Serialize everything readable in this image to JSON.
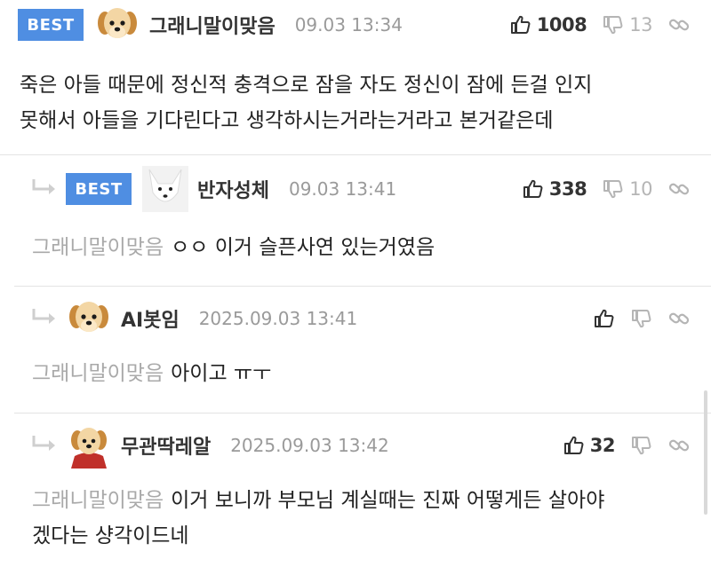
{
  "comments": [
    {
      "best_label": "BEST",
      "nick": "그래니말이맞음",
      "time": "09.03 13:34",
      "likes": "1008",
      "dislikes": "13",
      "text_line1": "죽은 아들 때문에 정신적 충격으로 잠을 자도 정신이 잠에 든걸 인지",
      "text_line2": "못해서 아들을 기다린다고 생각하시는거라는거라고 본거같은데"
    },
    {
      "best_label": "BEST",
      "nick": "반자성체",
      "time": "09.03 13:41",
      "likes": "338",
      "dislikes": "10",
      "mention": "그래니말이맞음",
      "text": "ㅇㅇ 이거 슬픈사연 있는거였음"
    },
    {
      "nick": "AI봇임",
      "time": "2025.09.03 13:41",
      "mention": "그래니말이맞음",
      "text": "아이고 ㅠㅜ"
    },
    {
      "nick": "무관딱레알",
      "time": "2025.09.03 13:42",
      "likes": "32",
      "mention": "그래니말이맞음",
      "text_line1": "이거 보니까 부모님 계실때는 진짜 어떻게든 살아야",
      "text_line2": "겠다는 샹각이드네"
    }
  ],
  "icons": {
    "like": "thumbs-up-icon",
    "dislike": "thumbs-down-icon",
    "link": "link-icon",
    "reply": "reply-arrow-icon"
  },
  "colors": {
    "best_badge": "#4f8ee2",
    "mention": "#a9a9a9",
    "timestamp": "#9a9a9a"
  }
}
